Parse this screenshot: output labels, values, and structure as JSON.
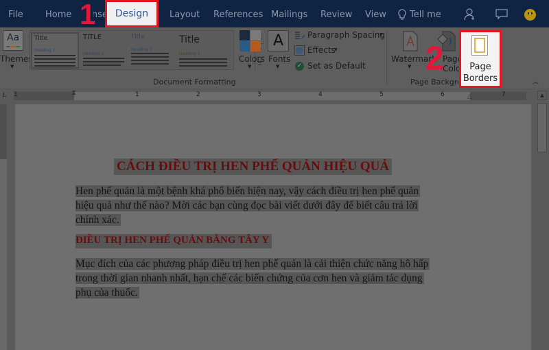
{
  "tabs": [
    {
      "label": "File"
    },
    {
      "label": "Home"
    },
    {
      "label": "Insert"
    },
    {
      "label": "Design",
      "active": true
    },
    {
      "label": "Layout"
    },
    {
      "label": "References"
    },
    {
      "label": "Mailings"
    },
    {
      "label": "Review"
    },
    {
      "label": "View"
    },
    {
      "label": "Tell me"
    }
  ],
  "annotations": {
    "step1": "1",
    "step2": "2"
  },
  "ribbon": {
    "themes_label": "Themes",
    "gallery": [
      {
        "title": "Title",
        "heading": "Heading 1"
      },
      {
        "title": "TITLE",
        "heading": "Heading 1"
      },
      {
        "title": "Title",
        "heading": "Heading 1"
      },
      {
        "title": "Title",
        "heading": "Heading 1"
      }
    ],
    "colors_label": "Colors",
    "fonts_label": "Fonts",
    "fonts_glyph": "A",
    "paragraph_spacing_label": "Paragraph Spacing",
    "effects_label": "Effects",
    "set_default_label": "Set as Default",
    "document_formatting_label": "Document Formatting",
    "watermark_label": "Watermark",
    "page_color_label_1": "Page",
    "page_color_label_2": "Color",
    "page_borders_label_1": "Page",
    "page_borders_label_2": "Borders",
    "page_background_label": "Page Background",
    "theme_colors": [
      "#1d2a3d",
      "#9a9a9a",
      "#2b5a86",
      "#b55a1c"
    ]
  },
  "ruler": {
    "tab_selector": "L",
    "numbers": [
      "1",
      "1",
      "2",
      "3",
      "4",
      "5",
      "6",
      "7"
    ]
  },
  "document": {
    "title": "CÁCH ĐIỀU TRỊ HEN PHẾ QUẢN HIỆU QUẢ",
    "para1": [
      "Hen phế quản là một bệnh khá phổ biến hiện nay, vậy cách điều trị hen phế quản",
      "hiệu quả như thế nào? Mời các bạn cùng đọc bài viết dưới đây để biết câu trả lời",
      "chính xác."
    ],
    "heading2": "ĐIỀU TRỊ HEN PHẾ QUẢN BẰNG TÂY Y",
    "para2": [
      "Mục đích của các phương pháp điều trị hen phế quản là cải thiện chức năng hô hấp",
      "trong thời gian nhanh nhất, hạn chế các biến chứng của cơn hen và giảm tác dụng",
      "phụ của thuốc."
    ]
  },
  "colors": {
    "highlight_red": "#e6141d",
    "title_bar": "#0f2343",
    "heading_text": "#6b0b0b"
  }
}
